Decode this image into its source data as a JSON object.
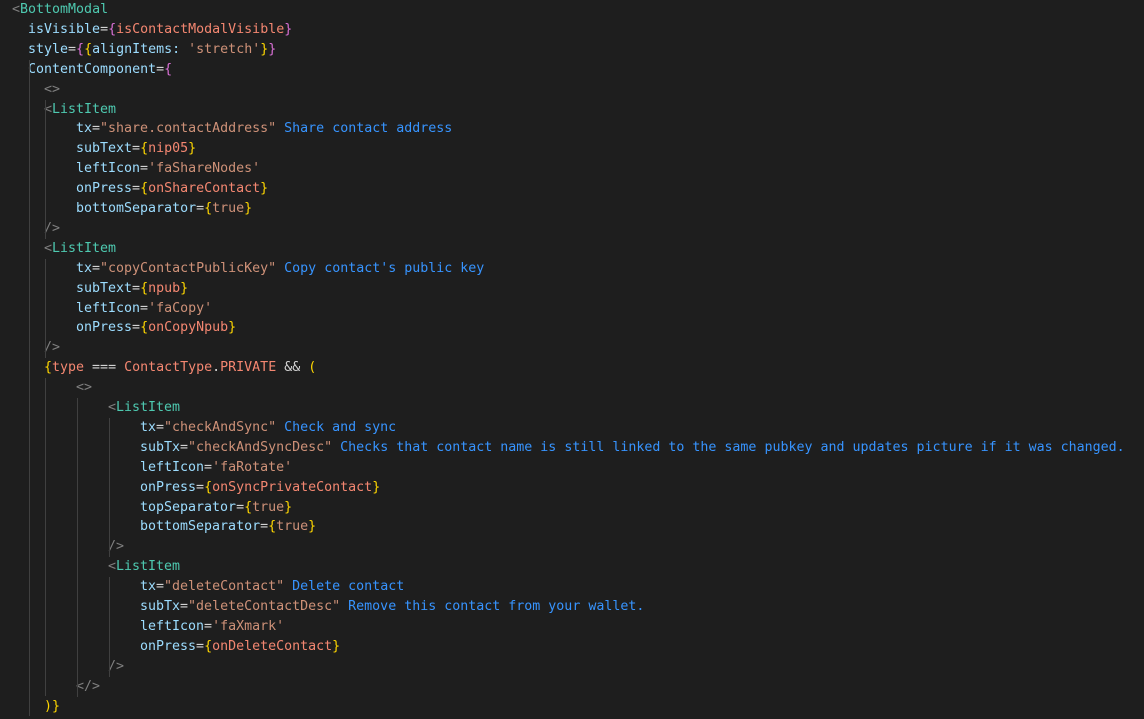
{
  "editor": {
    "language": "tsx",
    "theme_colors": {
      "background": "#1e1e1e",
      "tag": "#4ec9b0",
      "attribute": "#9cdcfe",
      "string": "#ce9178",
      "expression": "#f48771",
      "inline_hint": "#3794ff"
    },
    "lines": [
      [
        {
          "t": "<",
          "c": "punct"
        },
        {
          "t": "BottomModal",
          "c": "tag"
        }
      ],
      [
        {
          "t": "isVisible",
          "c": "attr"
        },
        {
          "t": "=",
          "c": "op"
        },
        {
          "t": "{",
          "c": "brace1"
        },
        {
          "t": "isContactModalVisible",
          "c": "expr"
        },
        {
          "t": "}",
          "c": "brace1"
        }
      ],
      [
        {
          "t": "style",
          "c": "attr"
        },
        {
          "t": "=",
          "c": "op"
        },
        {
          "t": "{",
          "c": "brace1"
        },
        {
          "t": "{",
          "c": "brace2"
        },
        {
          "t": "alignItems: ",
          "c": "attr"
        },
        {
          "t": "'stretch'",
          "c": "str"
        },
        {
          "t": "}",
          "c": "brace2"
        },
        {
          "t": "}",
          "c": "brace1"
        }
      ],
      [
        {
          "t": "ContentComponent",
          "c": "attr"
        },
        {
          "t": "=",
          "c": "op"
        },
        {
          "t": "{",
          "c": "brace1"
        }
      ],
      [
        {
          "t": "<>",
          "c": "punct"
        }
      ],
      [
        {
          "t": "<",
          "c": "punct"
        },
        {
          "t": "ListItem",
          "c": "tag"
        }
      ],
      [
        {
          "t": "tx",
          "c": "attr"
        },
        {
          "t": "=",
          "c": "op"
        },
        {
          "t": "\"share.contactAddress\"",
          "c": "str"
        },
        {
          "t": " Share contact address",
          "c": "note"
        }
      ],
      [
        {
          "t": "subText",
          "c": "attr"
        },
        {
          "t": "=",
          "c": "op"
        },
        {
          "t": "{",
          "c": "brace2"
        },
        {
          "t": "nip05",
          "c": "expr"
        },
        {
          "t": "}",
          "c": "brace2"
        }
      ],
      [
        {
          "t": "leftIcon",
          "c": "attr"
        },
        {
          "t": "=",
          "c": "op"
        },
        {
          "t": "'faShareNodes'",
          "c": "str"
        }
      ],
      [
        {
          "t": "onPress",
          "c": "attr"
        },
        {
          "t": "=",
          "c": "op"
        },
        {
          "t": "{",
          "c": "brace2"
        },
        {
          "t": "onShareContact",
          "c": "expr"
        },
        {
          "t": "}",
          "c": "brace2"
        }
      ],
      [
        {
          "t": "bottomSeparator",
          "c": "attr"
        },
        {
          "t": "=",
          "c": "op"
        },
        {
          "t": "{",
          "c": "brace2"
        },
        {
          "t": "true",
          "c": "bool"
        },
        {
          "t": "}",
          "c": "brace2"
        }
      ],
      [
        {
          "t": "/>",
          "c": "punct"
        }
      ],
      [
        {
          "t": "<",
          "c": "punct"
        },
        {
          "t": "ListItem",
          "c": "tag"
        }
      ],
      [
        {
          "t": "tx",
          "c": "attr"
        },
        {
          "t": "=",
          "c": "op"
        },
        {
          "t": "\"copyContactPublicKey\"",
          "c": "str"
        },
        {
          "t": " Copy contact's public key",
          "c": "note"
        }
      ],
      [
        {
          "t": "subText",
          "c": "attr"
        },
        {
          "t": "=",
          "c": "op"
        },
        {
          "t": "{",
          "c": "brace2"
        },
        {
          "t": "npub",
          "c": "expr"
        },
        {
          "t": "}",
          "c": "brace2"
        }
      ],
      [
        {
          "t": "leftIcon",
          "c": "attr"
        },
        {
          "t": "=",
          "c": "op"
        },
        {
          "t": "'faCopy'",
          "c": "str"
        }
      ],
      [
        {
          "t": "onPress",
          "c": "attr"
        },
        {
          "t": "=",
          "c": "op"
        },
        {
          "t": "{",
          "c": "brace2"
        },
        {
          "t": "onCopyNpub",
          "c": "expr"
        },
        {
          "t": "}",
          "c": "brace2"
        }
      ],
      [
        {
          "t": "/>",
          "c": "punct"
        }
      ],
      [
        {
          "t": "{",
          "c": "brace2"
        },
        {
          "t": "type",
          "c": "expr"
        },
        {
          "t": " === ",
          "c": "op"
        },
        {
          "t": "ContactType",
          "c": "expr"
        },
        {
          "t": ".",
          "c": "op"
        },
        {
          "t": "PRIVATE",
          "c": "expr"
        },
        {
          "t": " && ",
          "c": "op"
        },
        {
          "t": "(",
          "c": "brace2"
        }
      ],
      [
        {
          "t": "<>",
          "c": "punct"
        }
      ],
      [
        {
          "t": "<",
          "c": "punct"
        },
        {
          "t": "ListItem",
          "c": "tag"
        }
      ],
      [
        {
          "t": "tx",
          "c": "attr"
        },
        {
          "t": "=",
          "c": "op"
        },
        {
          "t": "\"checkAndSync\"",
          "c": "str"
        },
        {
          "t": " Check and sync",
          "c": "note"
        }
      ],
      [
        {
          "t": "subTx",
          "c": "attr"
        },
        {
          "t": "=",
          "c": "op"
        },
        {
          "t": "\"checkAndSyncDesc\"",
          "c": "str"
        },
        {
          "t": " Checks that contact name is still linked to the same pubkey and updates picture if it was changed.",
          "c": "note"
        }
      ],
      [
        {
          "t": "leftIcon",
          "c": "attr"
        },
        {
          "t": "=",
          "c": "op"
        },
        {
          "t": "'faRotate'",
          "c": "str"
        }
      ],
      [
        {
          "t": "onPress",
          "c": "attr"
        },
        {
          "t": "=",
          "c": "op"
        },
        {
          "t": "{",
          "c": "brace2"
        },
        {
          "t": "onSyncPrivateContact",
          "c": "expr"
        },
        {
          "t": "}",
          "c": "brace2"
        }
      ],
      [
        {
          "t": "topSeparator",
          "c": "attr"
        },
        {
          "t": "=",
          "c": "op"
        },
        {
          "t": "{",
          "c": "brace2"
        },
        {
          "t": "true",
          "c": "bool"
        },
        {
          "t": "}",
          "c": "brace2"
        }
      ],
      [
        {
          "t": "bottomSeparator",
          "c": "attr"
        },
        {
          "t": "=",
          "c": "op"
        },
        {
          "t": "{",
          "c": "brace2"
        },
        {
          "t": "true",
          "c": "bool"
        },
        {
          "t": "}",
          "c": "brace2"
        }
      ],
      [
        {
          "t": "/>",
          "c": "punct"
        }
      ],
      [
        {
          "t": "<",
          "c": "punct"
        },
        {
          "t": "ListItem",
          "c": "tag"
        }
      ],
      [
        {
          "t": "tx",
          "c": "attr"
        },
        {
          "t": "=",
          "c": "op"
        },
        {
          "t": "\"deleteContact\"",
          "c": "str"
        },
        {
          "t": " Delete contact",
          "c": "note"
        }
      ],
      [
        {
          "t": "subTx",
          "c": "attr"
        },
        {
          "t": "=",
          "c": "op"
        },
        {
          "t": "\"deleteContactDesc\"",
          "c": "str"
        },
        {
          "t": " Remove this contact from your wallet.",
          "c": "note"
        }
      ],
      [
        {
          "t": "leftIcon",
          "c": "attr"
        },
        {
          "t": "=",
          "c": "op"
        },
        {
          "t": "'faXmark'",
          "c": "str"
        }
      ],
      [
        {
          "t": "onPress",
          "c": "attr"
        },
        {
          "t": "=",
          "c": "op"
        },
        {
          "t": "{",
          "c": "brace2"
        },
        {
          "t": "onDeleteContact",
          "c": "expr"
        },
        {
          "t": "}",
          "c": "brace2"
        }
      ],
      [
        {
          "t": "/>",
          "c": "punct"
        }
      ],
      [
        {
          "t": "</>",
          "c": "punct"
        }
      ],
      [
        {
          "t": ")",
          "c": "brace2"
        },
        {
          "t": "}",
          "c": "brace2"
        }
      ]
    ]
  }
}
